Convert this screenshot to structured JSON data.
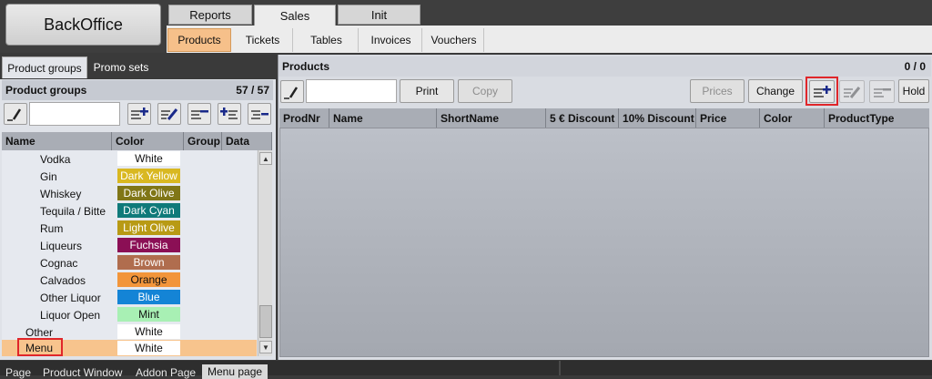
{
  "app": {
    "title": "BackOffice"
  },
  "main_tabs": [
    {
      "label": "Reports",
      "active": false
    },
    {
      "label": "Sales",
      "active": true
    },
    {
      "label": "Init",
      "active": false
    }
  ],
  "sub_tabs": [
    {
      "label": "Products",
      "active": true
    },
    {
      "label": "Tickets"
    },
    {
      "label": "Tables"
    },
    {
      "label": "Invoices"
    },
    {
      "label": "Vouchers"
    }
  ],
  "left_tabs": [
    {
      "label": "Product groups",
      "active": true
    },
    {
      "label": "Promo sets",
      "active": false
    }
  ],
  "product_groups": {
    "title": "Product groups",
    "count": "57  /  57",
    "search": {
      "value": "",
      "placeholder": ""
    },
    "columns": [
      "Name",
      "Color",
      "Group",
      "Data"
    ],
    "rows": [
      {
        "name": "Vodka",
        "color": "White",
        "bg": "#ffffff",
        "fg": "#111111",
        "level": 2
      },
      {
        "name": "Gin",
        "color": "Dark Yellow",
        "bg": "#d9b821",
        "fg": "#ffffff",
        "level": 2
      },
      {
        "name": "Whiskey",
        "color": "Dark Olive",
        "bg": "#807617",
        "fg": "#ffffff",
        "level": 2
      },
      {
        "name": "Tequila / Bitte",
        "color": "Dark Cyan",
        "bg": "#0f7a7a",
        "fg": "#ffffff",
        "level": 2
      },
      {
        "name": "Rum",
        "color": "Light Olive",
        "bg": "#b89a14",
        "fg": "#ffffff",
        "level": 2
      },
      {
        "name": "Liqueurs",
        "color": "Fuchsia",
        "bg": "#8b0f55",
        "fg": "#ffffff",
        "level": 2
      },
      {
        "name": "Cognac",
        "color": "Brown",
        "bg": "#b06d4e",
        "fg": "#ffffff",
        "level": 2
      },
      {
        "name": "Calvados",
        "color": "Orange",
        "bg": "#f2953a",
        "fg": "#111111",
        "level": 2
      },
      {
        "name": "Other Liquor",
        "color": "Blue",
        "bg": "#1484d6",
        "fg": "#ffffff",
        "level": 2
      },
      {
        "name": "Liquor Open",
        "color": "Mint",
        "bg": "#a8f0b4",
        "fg": "#111111",
        "level": 2
      },
      {
        "name": "Other",
        "color": "White",
        "bg": "#ffffff",
        "fg": "#111111",
        "level": 1
      },
      {
        "name": "Menu",
        "color": "White",
        "bg": "#ffffff",
        "fg": "#111111",
        "level": 1,
        "selected": true
      }
    ]
  },
  "products": {
    "title": "Products",
    "count": "0  /  0",
    "search": {
      "value": "",
      "placeholder": ""
    },
    "buttons": {
      "print": "Print",
      "copy": "Copy",
      "prices": "Prices",
      "change": "Change",
      "hold": "Hold"
    },
    "columns": [
      "ProdNr",
      "Name",
      "ShortName",
      "5 € Discount",
      "10% Discount",
      "Price",
      "Color",
      "ProductType"
    ]
  },
  "bottom_tabs": [
    {
      "label": "Page",
      "active": false
    },
    {
      "label": "Product Window",
      "active": false
    },
    {
      "label": "Addon Page",
      "active": false
    },
    {
      "label": "Menu page",
      "active": true
    }
  ],
  "icons": {
    "edit": "pencil-icon",
    "add": "list-add-icon",
    "edit_item": "list-edit-icon",
    "remove": "list-remove-icon",
    "add_sub": "list-add-sub-icon",
    "indent": "list-indent-icon"
  },
  "colors": {
    "selected_tab": "#f6c08a",
    "highlight": "#e0262a",
    "selected_row": "#f7c48d"
  }
}
